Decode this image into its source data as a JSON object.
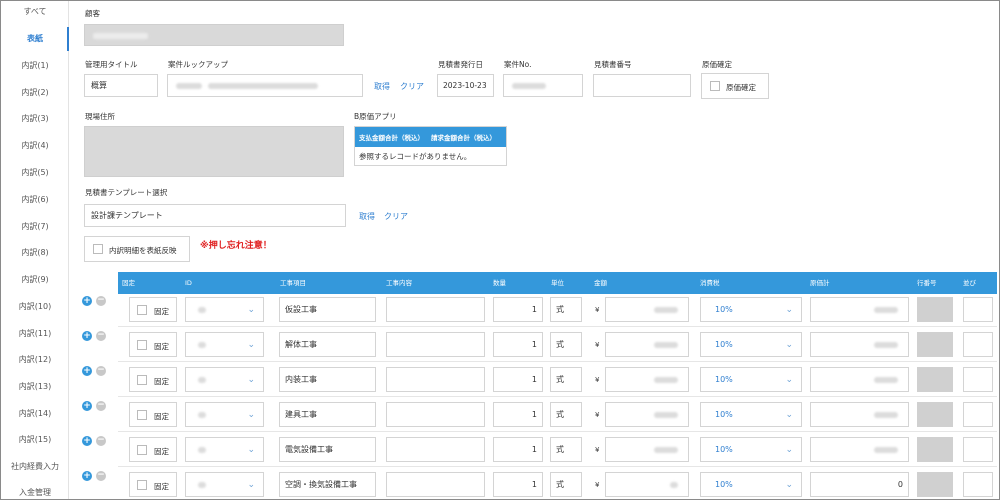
{
  "sidebar": {
    "items": [
      {
        "label": "すべて"
      },
      {
        "label": "表紙",
        "active": true
      },
      {
        "label": "内訳(1)"
      },
      {
        "label": "内訳(2)"
      },
      {
        "label": "内訳(3)"
      },
      {
        "label": "内訳(4)"
      },
      {
        "label": "内訳(5)"
      },
      {
        "label": "内訳(6)"
      },
      {
        "label": "内訳(7)"
      },
      {
        "label": "内訳(8)"
      },
      {
        "label": "内訳(9)"
      },
      {
        "label": "内訳(10)"
      },
      {
        "label": "内訳(11)"
      },
      {
        "label": "内訳(12)"
      },
      {
        "label": "内訳(13)"
      },
      {
        "label": "内訳(14)"
      },
      {
        "label": "内訳(15)"
      },
      {
        "label": "社内経費入力"
      },
      {
        "label": "入金管理"
      }
    ]
  },
  "form": {
    "customer_label": "顧客",
    "mgmt_title_label": "管理用タイトル",
    "mgmt_title_value": "概算",
    "case_lookup_label": "案件ルックアップ",
    "fetch_label": "取得",
    "clear_label": "クリア",
    "issue_date_label": "見積書発行日",
    "issue_date_value": "2023-10-23",
    "case_no_label": "案件No.",
    "estimate_no_label": "見積書番号",
    "cost_confirm_label": "原価確定",
    "cost_confirm_checkbox_label": "原価確定",
    "site_address_label": "現場住所",
    "b_cost_app_label": "B原価アプリ",
    "b_cost_app_columns": [
      "支払金額合計（税込）",
      "請求金額合計（税込）"
    ],
    "b_cost_app_empty": "参照するレコードがありません。",
    "template_label": "見積書テンプレート選択",
    "template_value": "設計課テンプレート",
    "reflect_label": "内訳明細を表紙反映",
    "warning": "※押し忘れ注意！"
  },
  "table": {
    "headers": [
      "固定",
      "ID",
      "工事項目",
      "工事内容",
      "数量",
      "単位",
      "金額",
      "消費税",
      "原価計",
      "行番号",
      "並び"
    ],
    "fixed_label": "固定",
    "currency_symbol": "¥",
    "rows": [
      {
        "item": "仮設工事",
        "qty": "1",
        "unit": "式",
        "tax": "10%",
        "cost": ""
      },
      {
        "item": "解体工事",
        "qty": "1",
        "unit": "式",
        "tax": "10%",
        "cost": ""
      },
      {
        "item": "内装工事",
        "qty": "1",
        "unit": "式",
        "tax": "10%",
        "cost": ""
      },
      {
        "item": "建具工事",
        "qty": "1",
        "unit": "式",
        "tax": "10%",
        "cost": ""
      },
      {
        "item": "電気設備工事",
        "qty": "1",
        "unit": "式",
        "tax": "10%",
        "cost": ""
      },
      {
        "item": "空調・換気設備工事",
        "qty": "1",
        "unit": "式",
        "tax": "10%",
        "cost": "0"
      }
    ]
  },
  "colors": {
    "accent": "#3498db",
    "link": "#2f7fd0",
    "warning": "#e02020"
  }
}
